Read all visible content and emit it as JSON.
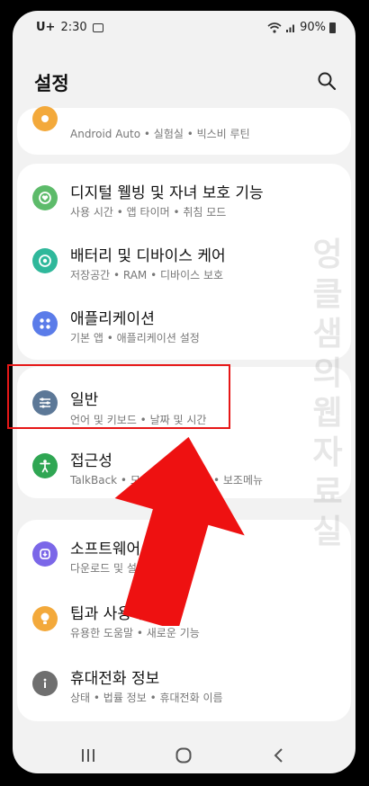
{
  "status": {
    "carrier": "U+",
    "time": "2:30",
    "battery": "90%"
  },
  "header": {
    "title": "설정",
    "search_icon": "search-icon"
  },
  "items": {
    "partial": {
      "subtitle": "Android Auto • 실험실 • 빅스비 루틴"
    },
    "wellbeing": {
      "title": "디지털 웰빙 및 자녀 보호 기능",
      "subtitle": "사용 시간 • 앱 타이머 • 취침 모드",
      "color": "#5dbb6a"
    },
    "battery": {
      "title": "배터리 및 디바이스 케어",
      "subtitle": "저장공간 • RAM • 디바이스 보호",
      "color": "#2fb89b"
    },
    "apps": {
      "title": "애플리케이션",
      "subtitle": "기본 앱 • 애플리케이션 설정",
      "color": "#5b7ce9"
    },
    "general": {
      "title": "일반",
      "subtitle": "언어 및 키보드 • 날짜 및 시간",
      "color": "#5c7897"
    },
    "accessibility": {
      "title": "접근성",
      "subtitle_left": "TalkBack • 모",
      "subtitle_right": "• 보조메뉴",
      "color": "#2fa653"
    },
    "software": {
      "title": "소프트웨어 업",
      "subtitle": "다운로드 및 설치",
      "color": "#7b67e8"
    },
    "tips": {
      "title": "팁과 사용 설명서",
      "subtitle": "유용한 도움말 • 새로운 기능",
      "color": "#f3a93b"
    },
    "about": {
      "title": "휴대전화 정보",
      "subtitle": "상태 • 법률 정보 • 휴대전화 이름",
      "color": "#6f6f6f"
    }
  },
  "watermark": "엉클샘의웹자료실",
  "annotation": {
    "arrow_color": "#ee1111",
    "box_color": "#e61717"
  }
}
